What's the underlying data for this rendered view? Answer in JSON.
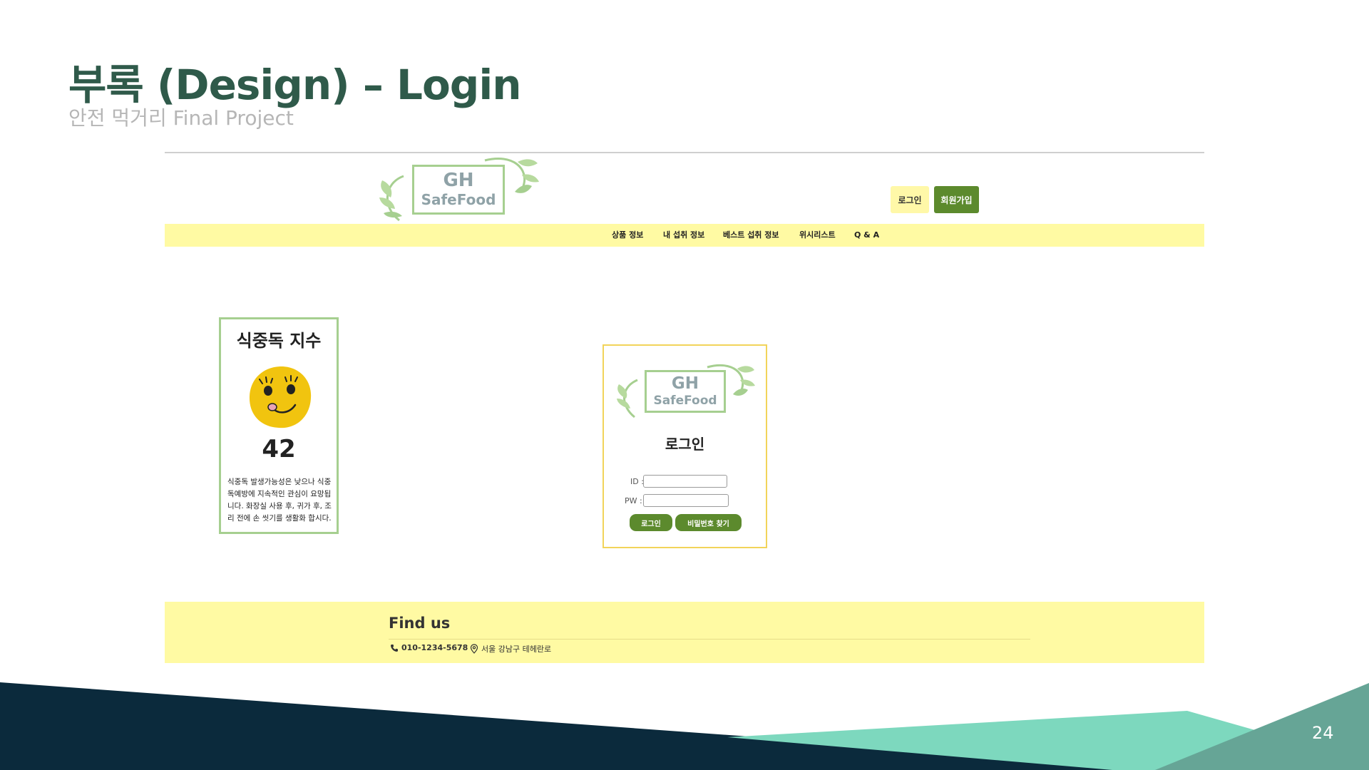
{
  "slide": {
    "title": "부록 (Design) – Login",
    "subtitle": "안전 먹거리 Final Project",
    "page_number": "24"
  },
  "site": {
    "logo": {
      "line1": "GH",
      "line2": "SafeFood"
    },
    "header_buttons": {
      "login": "로그인",
      "signup": "회원가입"
    },
    "nav": [
      "상품 정보",
      "내 섭취 정보",
      "베스트 섭취 정보",
      "위시리스트",
      "Q & A"
    ]
  },
  "food_poisoning": {
    "title": "식중독 지수",
    "value": "42",
    "description": "식중독 발생가능성은 낮으나 식중독예방에 지속적인 관심이 요망됩니다. 화장실 사용 후, 귀가 후, 조리 전에 손 씻기를 생활화 합시다."
  },
  "login_card": {
    "heading": "로그인",
    "id_label": "ID :",
    "pw_label": "PW :",
    "id_value": "",
    "pw_value": "",
    "login_button": "로그인",
    "find_pw_button": "비밀번호 찾기"
  },
  "footer": {
    "heading": "Find us",
    "phone": "010-1234-5678",
    "address": "서울 강남구 테헤란로"
  },
  "colors": {
    "title": "#2f5a4a",
    "accent_green": "#5c8a2d",
    "nav_yellow": "#fffaa3",
    "card_border_green": "#a6cf90",
    "card_border_yellow": "#f2d45a",
    "navy": "#0b2a3c",
    "teal": "#7dd8be",
    "smiley": "#f1c40f"
  },
  "icons": [
    "leaf-logo-icon",
    "smiley-icon",
    "phone-icon",
    "location-pin-icon"
  ]
}
